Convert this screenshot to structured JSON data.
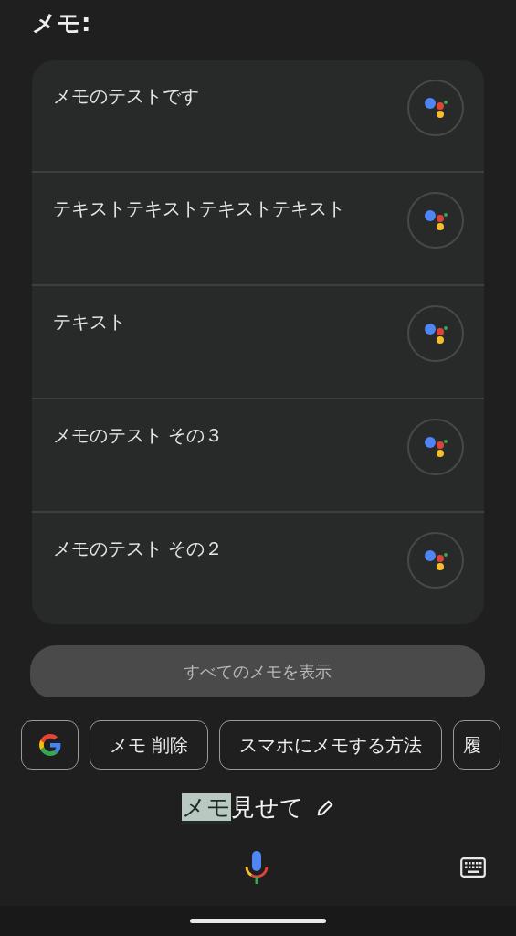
{
  "title": "メモ:",
  "memos": [
    {
      "text": "メモのテストです"
    },
    {
      "text": "テキストテキストテキストテキスト"
    },
    {
      "text": "テキスト"
    },
    {
      "text": "メモのテスト その３"
    },
    {
      "text": "メモのテスト その２"
    }
  ],
  "show_all_button": "すべてのメモを表示",
  "chips": [
    {
      "kind": "google"
    },
    {
      "kind": "text",
      "label": "メモ 削除"
    },
    {
      "kind": "text",
      "label": "スマホにメモする方法"
    },
    {
      "kind": "text",
      "label": "履"
    }
  ],
  "query": {
    "highlighted": "メモ",
    "rest": "見せて"
  }
}
